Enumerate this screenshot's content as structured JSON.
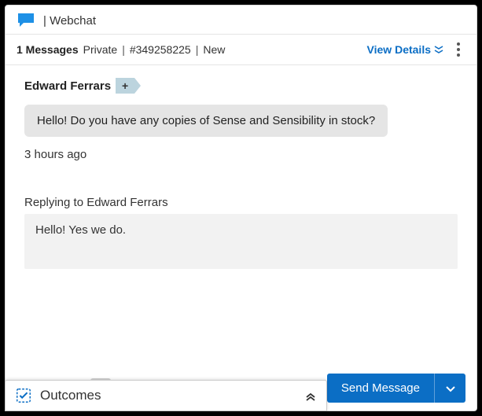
{
  "header": {
    "channel_label": "| Webchat"
  },
  "meta": {
    "message_count": "1 Messages",
    "visibility": "Private",
    "ticket_ref": "#349258225",
    "status": "New",
    "view_details_label": "View Details"
  },
  "conversation": {
    "sender_name": "Edward Ferrars",
    "add_tag_glyph": "+",
    "message_text": "Hello! Do you have any copies of Sense and Sensibility in stock?",
    "timestamp": "3 hours ago"
  },
  "reply": {
    "replying_to_label": "Replying to Edward Ferrars",
    "draft_text": "Hello! Yes we do."
  },
  "toolbar": {
    "send_label": "Send Message"
  },
  "outcomes": {
    "label": "Outcomes"
  }
}
